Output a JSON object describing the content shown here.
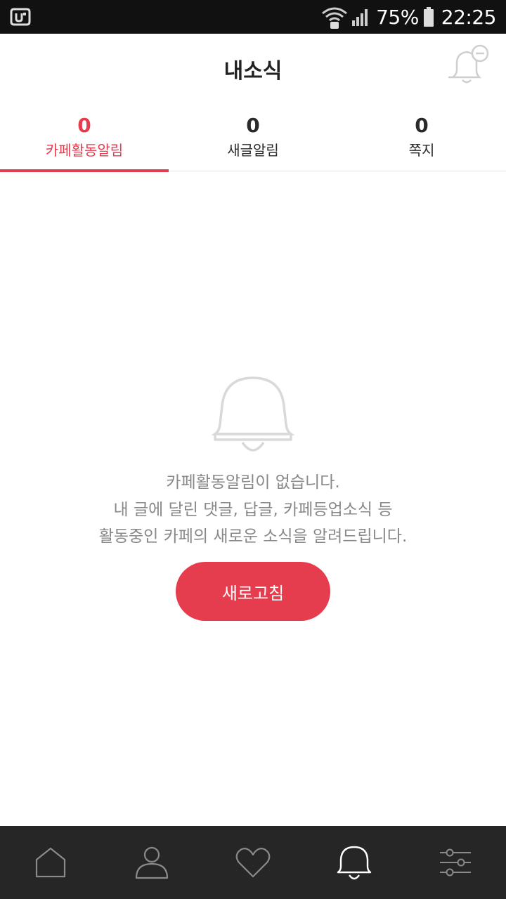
{
  "status_bar": {
    "battery": "75%",
    "time": "22:25"
  },
  "header": {
    "title": "내소식",
    "right_icon": "bell-minus-icon"
  },
  "tabs": [
    {
      "count": "0",
      "label": "카페활동알림",
      "active": true
    },
    {
      "count": "0",
      "label": "새글알림",
      "active": false
    },
    {
      "count": "0",
      "label": "쪽지",
      "active": false
    }
  ],
  "empty_state": {
    "icon": "bell-icon",
    "lines": [
      "카페활동알림이 없습니다.",
      "내 글에 달린 댓글, 답글, 카페등업소식 등",
      "활동중인 카페의 새로운 소식을 알려드립니다."
    ],
    "button_label": "새로고침"
  },
  "bottom_nav": [
    {
      "icon": "home-icon",
      "active": false
    },
    {
      "icon": "person-icon",
      "active": false
    },
    {
      "icon": "heart-icon",
      "active": false
    },
    {
      "icon": "bell-icon",
      "active": true
    },
    {
      "icon": "settings-sliders-icon",
      "active": false
    }
  ],
  "colors": {
    "accent": "#e53c4e",
    "text_dark": "#2a2a2a",
    "text_muted": "#888888",
    "nav_bg": "#262626",
    "status_bg": "#111111"
  }
}
